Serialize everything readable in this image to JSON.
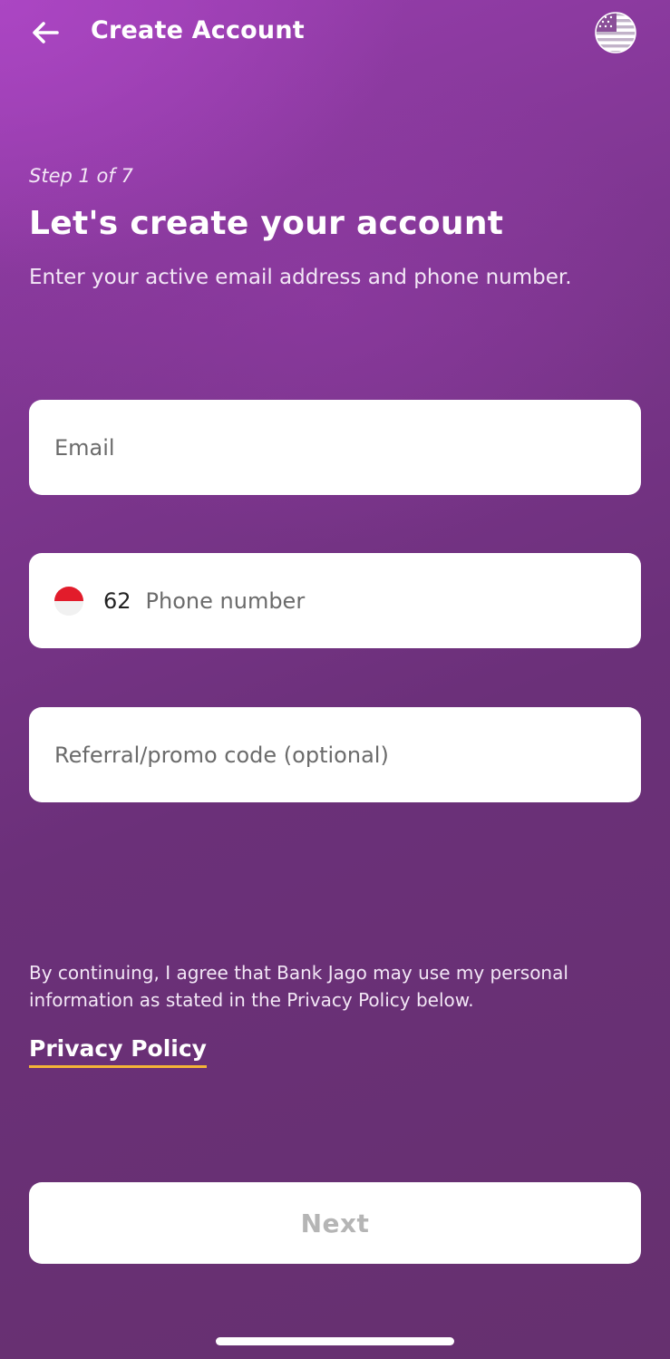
{
  "header": {
    "title": "Create Account",
    "back_icon": "arrow-left-icon",
    "language_icon": "us-flag-icon"
  },
  "intro": {
    "step": "Step 1 of 7",
    "title": "Let's create your account",
    "subtitle": "Enter your active email address and phone number."
  },
  "form": {
    "email": {
      "value": "",
      "placeholder": "Email"
    },
    "phone": {
      "country_flag_icon": "indonesia-flag-icon",
      "country_code": "62",
      "value": "",
      "placeholder": "Phone number"
    },
    "referral": {
      "value": "",
      "placeholder": "Referral/promo code (optional)"
    }
  },
  "legal": {
    "text": "By continuing, I agree that Bank Jago may use my personal information as stated in the Privacy Policy below.",
    "link_label": "Privacy Policy"
  },
  "actions": {
    "next_label": "Next",
    "next_enabled": false
  },
  "colors": {
    "background_top": "#9a3eb0",
    "background_bottom": "#66306f",
    "link_underline": "#f4b437",
    "disabled_text": "#b5b5b5"
  }
}
